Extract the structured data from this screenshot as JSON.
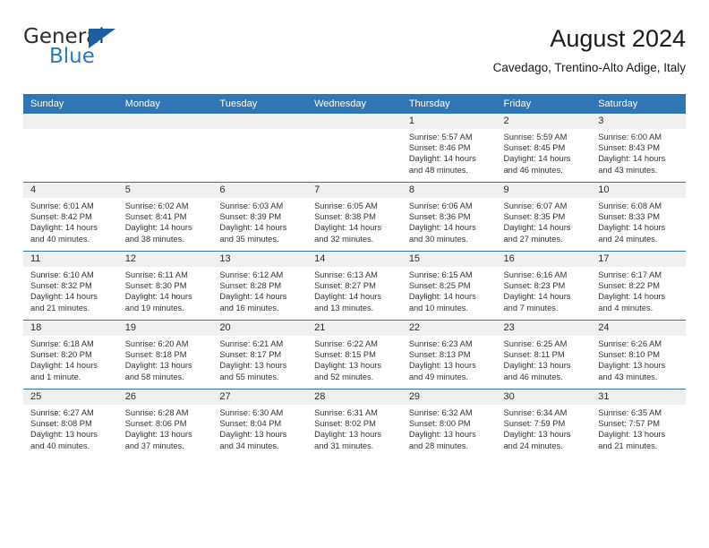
{
  "logo": {
    "word1": "General",
    "word2": "Blue",
    "triangle_color": "#1a5fa0",
    "blue_color": "#2a7ac0"
  },
  "header": {
    "title": "August 2024",
    "subtitle": "Cavedago, Trentino-Alto Adige, Italy",
    "accent_color": "#3176b4"
  },
  "calendar": {
    "weekday_headers": [
      "Sunday",
      "Monday",
      "Tuesday",
      "Wednesday",
      "Thursday",
      "Friday",
      "Saturday"
    ],
    "weeks": [
      [
        {
          "day": "",
          "empty": true
        },
        {
          "day": "",
          "empty": true
        },
        {
          "day": "",
          "empty": true
        },
        {
          "day": "",
          "empty": true
        },
        {
          "day": "1",
          "sunrise": "Sunrise: 5:57 AM",
          "sunset": "Sunset: 8:46 PM",
          "daylight1": "Daylight: 14 hours",
          "daylight2": "and 48 minutes."
        },
        {
          "day": "2",
          "sunrise": "Sunrise: 5:59 AM",
          "sunset": "Sunset: 8:45 PM",
          "daylight1": "Daylight: 14 hours",
          "daylight2": "and 46 minutes."
        },
        {
          "day": "3",
          "sunrise": "Sunrise: 6:00 AM",
          "sunset": "Sunset: 8:43 PM",
          "daylight1": "Daylight: 14 hours",
          "daylight2": "and 43 minutes."
        }
      ],
      [
        {
          "day": "4",
          "sunrise": "Sunrise: 6:01 AM",
          "sunset": "Sunset: 8:42 PM",
          "daylight1": "Daylight: 14 hours",
          "daylight2": "and 40 minutes."
        },
        {
          "day": "5",
          "sunrise": "Sunrise: 6:02 AM",
          "sunset": "Sunset: 8:41 PM",
          "daylight1": "Daylight: 14 hours",
          "daylight2": "and 38 minutes."
        },
        {
          "day": "6",
          "sunrise": "Sunrise: 6:03 AM",
          "sunset": "Sunset: 8:39 PM",
          "daylight1": "Daylight: 14 hours",
          "daylight2": "and 35 minutes."
        },
        {
          "day": "7",
          "sunrise": "Sunrise: 6:05 AM",
          "sunset": "Sunset: 8:38 PM",
          "daylight1": "Daylight: 14 hours",
          "daylight2": "and 32 minutes."
        },
        {
          "day": "8",
          "sunrise": "Sunrise: 6:06 AM",
          "sunset": "Sunset: 8:36 PM",
          "daylight1": "Daylight: 14 hours",
          "daylight2": "and 30 minutes."
        },
        {
          "day": "9",
          "sunrise": "Sunrise: 6:07 AM",
          "sunset": "Sunset: 8:35 PM",
          "daylight1": "Daylight: 14 hours",
          "daylight2": "and 27 minutes."
        },
        {
          "day": "10",
          "sunrise": "Sunrise: 6:08 AM",
          "sunset": "Sunset: 8:33 PM",
          "daylight1": "Daylight: 14 hours",
          "daylight2": "and 24 minutes."
        }
      ],
      [
        {
          "day": "11",
          "sunrise": "Sunrise: 6:10 AM",
          "sunset": "Sunset: 8:32 PM",
          "daylight1": "Daylight: 14 hours",
          "daylight2": "and 21 minutes."
        },
        {
          "day": "12",
          "sunrise": "Sunrise: 6:11 AM",
          "sunset": "Sunset: 8:30 PM",
          "daylight1": "Daylight: 14 hours",
          "daylight2": "and 19 minutes."
        },
        {
          "day": "13",
          "sunrise": "Sunrise: 6:12 AM",
          "sunset": "Sunset: 8:28 PM",
          "daylight1": "Daylight: 14 hours",
          "daylight2": "and 16 minutes."
        },
        {
          "day": "14",
          "sunrise": "Sunrise: 6:13 AM",
          "sunset": "Sunset: 8:27 PM",
          "daylight1": "Daylight: 14 hours",
          "daylight2": "and 13 minutes."
        },
        {
          "day": "15",
          "sunrise": "Sunrise: 6:15 AM",
          "sunset": "Sunset: 8:25 PM",
          "daylight1": "Daylight: 14 hours",
          "daylight2": "and 10 minutes."
        },
        {
          "day": "16",
          "sunrise": "Sunrise: 6:16 AM",
          "sunset": "Sunset: 8:23 PM",
          "daylight1": "Daylight: 14 hours",
          "daylight2": "and 7 minutes."
        },
        {
          "day": "17",
          "sunrise": "Sunrise: 6:17 AM",
          "sunset": "Sunset: 8:22 PM",
          "daylight1": "Daylight: 14 hours",
          "daylight2": "and 4 minutes."
        }
      ],
      [
        {
          "day": "18",
          "sunrise": "Sunrise: 6:18 AM",
          "sunset": "Sunset: 8:20 PM",
          "daylight1": "Daylight: 14 hours",
          "daylight2": "and 1 minute."
        },
        {
          "day": "19",
          "sunrise": "Sunrise: 6:20 AM",
          "sunset": "Sunset: 8:18 PM",
          "daylight1": "Daylight: 13 hours",
          "daylight2": "and 58 minutes."
        },
        {
          "day": "20",
          "sunrise": "Sunrise: 6:21 AM",
          "sunset": "Sunset: 8:17 PM",
          "daylight1": "Daylight: 13 hours",
          "daylight2": "and 55 minutes."
        },
        {
          "day": "21",
          "sunrise": "Sunrise: 6:22 AM",
          "sunset": "Sunset: 8:15 PM",
          "daylight1": "Daylight: 13 hours",
          "daylight2": "and 52 minutes."
        },
        {
          "day": "22",
          "sunrise": "Sunrise: 6:23 AM",
          "sunset": "Sunset: 8:13 PM",
          "daylight1": "Daylight: 13 hours",
          "daylight2": "and 49 minutes."
        },
        {
          "day": "23",
          "sunrise": "Sunrise: 6:25 AM",
          "sunset": "Sunset: 8:11 PM",
          "daylight1": "Daylight: 13 hours",
          "daylight2": "and 46 minutes."
        },
        {
          "day": "24",
          "sunrise": "Sunrise: 6:26 AM",
          "sunset": "Sunset: 8:10 PM",
          "daylight1": "Daylight: 13 hours",
          "daylight2": "and 43 minutes."
        }
      ],
      [
        {
          "day": "25",
          "sunrise": "Sunrise: 6:27 AM",
          "sunset": "Sunset: 8:08 PM",
          "daylight1": "Daylight: 13 hours",
          "daylight2": "and 40 minutes."
        },
        {
          "day": "26",
          "sunrise": "Sunrise: 6:28 AM",
          "sunset": "Sunset: 8:06 PM",
          "daylight1": "Daylight: 13 hours",
          "daylight2": "and 37 minutes."
        },
        {
          "day": "27",
          "sunrise": "Sunrise: 6:30 AM",
          "sunset": "Sunset: 8:04 PM",
          "daylight1": "Daylight: 13 hours",
          "daylight2": "and 34 minutes."
        },
        {
          "day": "28",
          "sunrise": "Sunrise: 6:31 AM",
          "sunset": "Sunset: 8:02 PM",
          "daylight1": "Daylight: 13 hours",
          "daylight2": "and 31 minutes."
        },
        {
          "day": "29",
          "sunrise": "Sunrise: 6:32 AM",
          "sunset": "Sunset: 8:00 PM",
          "daylight1": "Daylight: 13 hours",
          "daylight2": "and 28 minutes."
        },
        {
          "day": "30",
          "sunrise": "Sunrise: 6:34 AM",
          "sunset": "Sunset: 7:59 PM",
          "daylight1": "Daylight: 13 hours",
          "daylight2": "and 24 minutes."
        },
        {
          "day": "31",
          "sunrise": "Sunrise: 6:35 AM",
          "sunset": "Sunset: 7:57 PM",
          "daylight1": "Daylight: 13 hours",
          "daylight2": "and 21 minutes."
        }
      ]
    ]
  }
}
